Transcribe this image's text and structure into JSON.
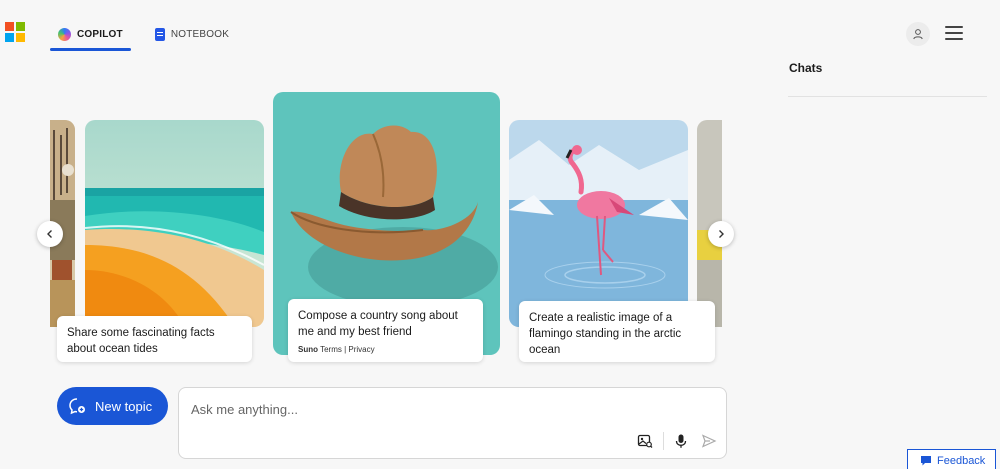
{
  "header": {
    "logo": {
      "name": "microsoft-logo",
      "colors": [
        "#f25022",
        "#7fba00",
        "#00a4ef",
        "#ffb900"
      ]
    },
    "tabs": [
      {
        "label": "COPILOT",
        "icon": "copilot-icon",
        "active": true
      },
      {
        "label": "NOTEBOOK",
        "icon": "notebook-icon",
        "active": false
      }
    ],
    "profile_icon": "person-icon",
    "menu_icon": "hamburger-menu-icon"
  },
  "side_panel": {
    "title": "Chats"
  },
  "carousel": {
    "prev_icon": "chevron-left-icon",
    "next_icon": "chevron-right-icon",
    "cards": [
      {
        "prompt": "Share some fascinating facts about ocean tides",
        "image": "beach-ocean-illustration"
      },
      {
        "prompt": "Compose a country song about me and my best friend",
        "image": "cowboy-hat-illustration",
        "plugin": "Suno",
        "links": "Terms | Privacy"
      },
      {
        "prompt": "Create a realistic image of a flamingo standing in the arctic ocean",
        "image": "flamingo-arctic-illustration"
      }
    ]
  },
  "composer": {
    "new_topic_label": "New topic",
    "new_topic_icon": "new-chat-icon",
    "placeholder": "Ask me anything...",
    "tools": [
      "image-search-icon",
      "microphone-icon",
      "send-icon"
    ]
  },
  "feedback": {
    "label": "Feedback",
    "icon": "feedback-icon"
  },
  "colors": {
    "accent": "#1a56d6",
    "background": "#f7f7f7"
  }
}
